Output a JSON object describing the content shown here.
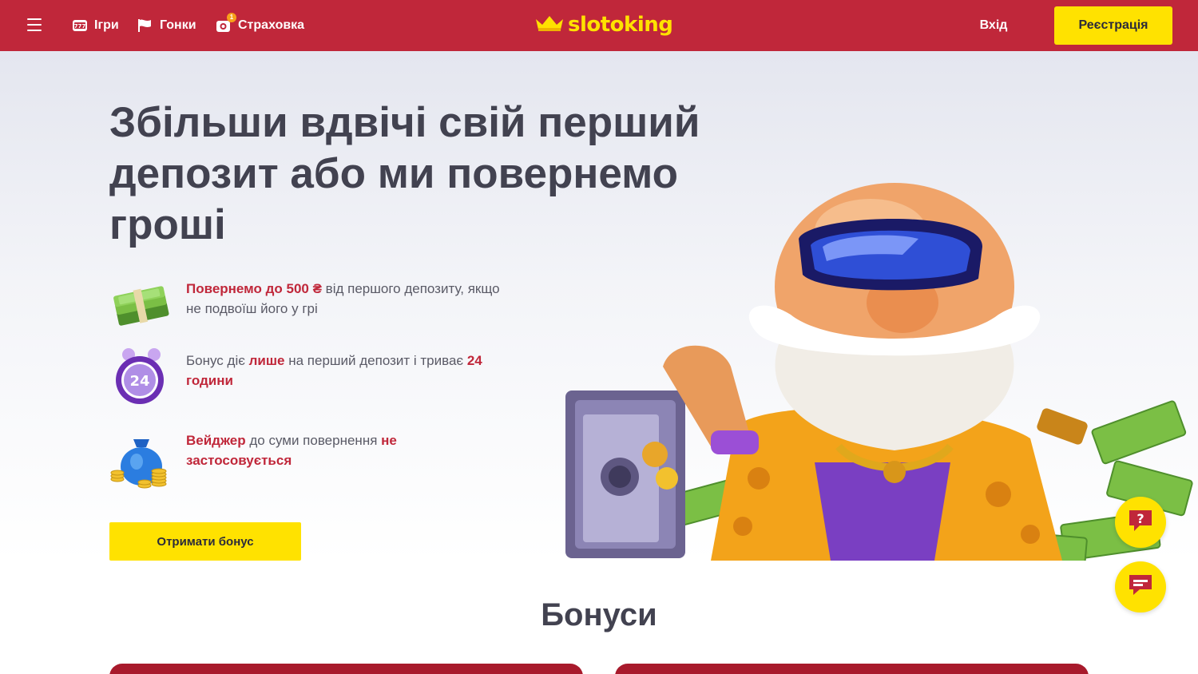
{
  "header": {
    "nav": [
      {
        "label": "Ігри",
        "icon": "slot-777-icon"
      },
      {
        "label": "Гонки",
        "icon": "race-flag-icon"
      },
      {
        "label": "Страховка",
        "icon": "insurance-icon",
        "badge": "1"
      }
    ],
    "logo_text": "slotoking",
    "login_label": "Вхід",
    "register_label": "Реєстрація"
  },
  "hero": {
    "title": "Збільши вдвічі свій перший депозит або ми повернемо гроші",
    "features": [
      {
        "icon": "money-stack-icon",
        "parts": [
          {
            "text": "Повернемо до 500 ₴",
            "highlight": true
          },
          {
            "text": " від першого депозиту, якщо не подвоїш його у грі",
            "highlight": false
          }
        ]
      },
      {
        "icon": "alarm-clock-24-icon",
        "clock_label": "24",
        "parts": [
          {
            "text": "Бонус діє ",
            "highlight": false
          },
          {
            "text": "лише",
            "highlight": true
          },
          {
            "text": " на перший депозит і триває ",
            "highlight": false
          },
          {
            "text": "24 години",
            "highlight": true
          }
        ]
      },
      {
        "icon": "money-bag-coins-icon",
        "parts": [
          {
            "text": "Вейджер",
            "highlight": true
          },
          {
            "text": " до суми повернення ",
            "highlight": false
          },
          {
            "text": "не застосовується",
            "highlight": true
          }
        ]
      }
    ],
    "cta_label": "Отримати бонус"
  },
  "bonuses": {
    "title": "Бонуси"
  },
  "colors": {
    "brand_red": "#c0273a",
    "accent_yellow": "#ffe200",
    "text_dark": "#424250",
    "text_gray": "#5a5a66",
    "card_red": "#a81a2c"
  }
}
